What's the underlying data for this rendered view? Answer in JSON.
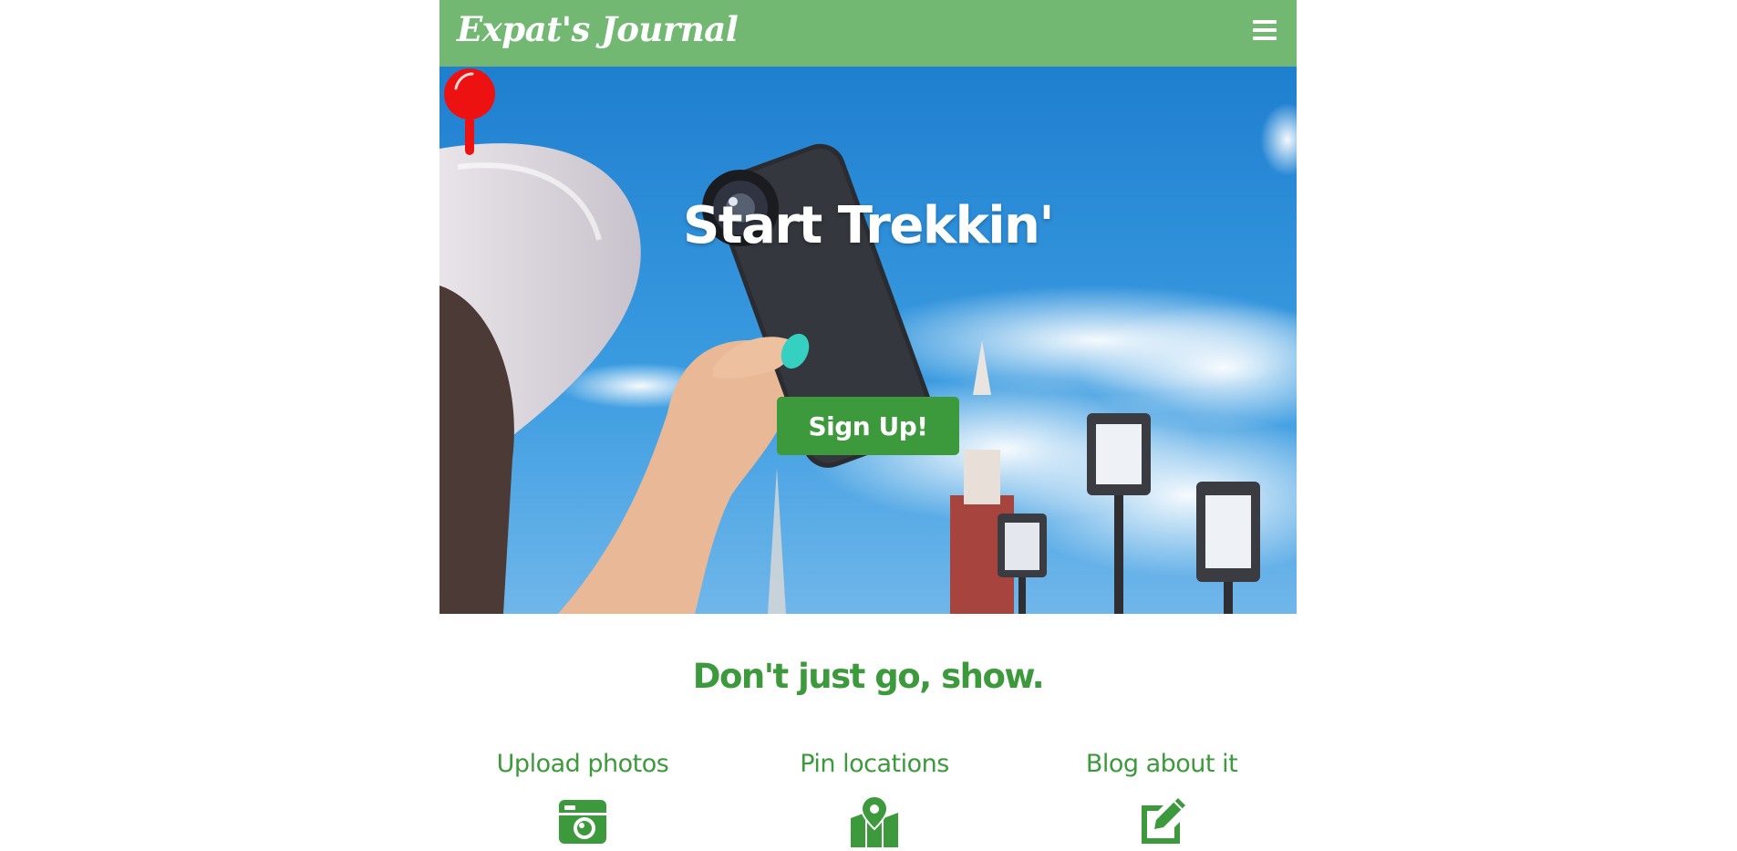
{
  "navbar": {
    "brand": "Expat's Journal",
    "menu_icon": "hamburger-menu-icon"
  },
  "hero": {
    "title": "Start Trekkin'",
    "pin_icon": "map-pin-icon",
    "signup_label": "Sign Up!"
  },
  "tagline": "Don't just go, show.",
  "features": [
    {
      "label": "Upload photos",
      "icon": "camera-icon"
    },
    {
      "label": "Pin locations",
      "icon": "map-location-icon"
    },
    {
      "label": "Blog about it",
      "icon": "edit-icon"
    }
  ],
  "colors": {
    "navbar_bg": "#72b873",
    "accent_green": "#3c9a3c",
    "pin_red": "#ee1111",
    "white": "#ffffff"
  }
}
